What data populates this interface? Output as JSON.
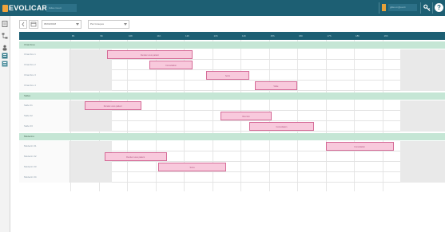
{
  "app": {
    "logo_text": "EVOLICARE",
    "subtitle": "Gilles Court",
    "user_name": "gilles.m@evoli"
  },
  "icons": {
    "key": "key-icon",
    "help": "help-icon",
    "help_glyph": "?",
    "sidebar": [
      "document-icon",
      "tree-icon",
      "people-icon",
      "chart-icon",
      "list-icon"
    ]
  },
  "toolbar": {
    "date_value": "05/03/2018",
    "group_value": "Par Groupes"
  },
  "timeline": {
    "hours": [
      "8h",
      "9h",
      "10h",
      "11h",
      "12h",
      "13h",
      "14h",
      "15h",
      "16h",
      "17h",
      "18h",
      "19h"
    ]
  },
  "sections": [
    {
      "label": "Chambres",
      "rows": [
        {
          "label": "Chambre 1",
          "events": [
            {
              "start": 9.3,
              "end": 12.3,
              "text": "Rendez-vous patient"
            }
          ]
        },
        {
          "label": "Chambre 2",
          "events": [
            {
              "start": 10.8,
              "end": 12.3,
              "text": "Consultation"
            }
          ]
        },
        {
          "label": "Chambre 3",
          "events": [
            {
              "start": 12.8,
              "end": 14.3,
              "text": "Soins"
            }
          ]
        },
        {
          "label": "Chambre 4",
          "events": [
            {
              "start": 14.5,
              "end": 16.0,
              "text": "Visite"
            }
          ]
        }
      ]
    },
    {
      "label": "Salles",
      "rows": [
        {
          "label": "Salle 01",
          "events": [
            {
              "start": 8.5,
              "end": 10.5,
              "text": "Rendez-vous patient"
            }
          ]
        },
        {
          "label": "Salle 02",
          "events": [
            {
              "start": 13.3,
              "end": 15.1,
              "text": "Réunion"
            }
          ]
        },
        {
          "label": "Salle 03",
          "events": [
            {
              "start": 14.3,
              "end": 16.6,
              "text": "Consultation"
            }
          ]
        }
      ]
    },
    {
      "label": "Médecins",
      "rows": [
        {
          "label": "Médecin 01",
          "events": [
            {
              "start": 17.0,
              "end": 19.4,
              "text": "Consultation"
            }
          ]
        },
        {
          "label": "Médecin 02",
          "events": [
            {
              "start": 9.2,
              "end": 11.4,
              "text": "Rendez-vous patient"
            }
          ]
        },
        {
          "label": "Médecin 03",
          "events": [
            {
              "start": 11.1,
              "end": 13.5,
              "text": "Soins"
            }
          ]
        },
        {
          "label": "Médecin 04",
          "events": []
        }
      ]
    }
  ],
  "colors": {
    "topbar": "#1d5f73",
    "section": "#c5e6d5",
    "event_fill": "#f8c9dc",
    "event_border": "#d56b97",
    "accent": "#f0a33b"
  }
}
